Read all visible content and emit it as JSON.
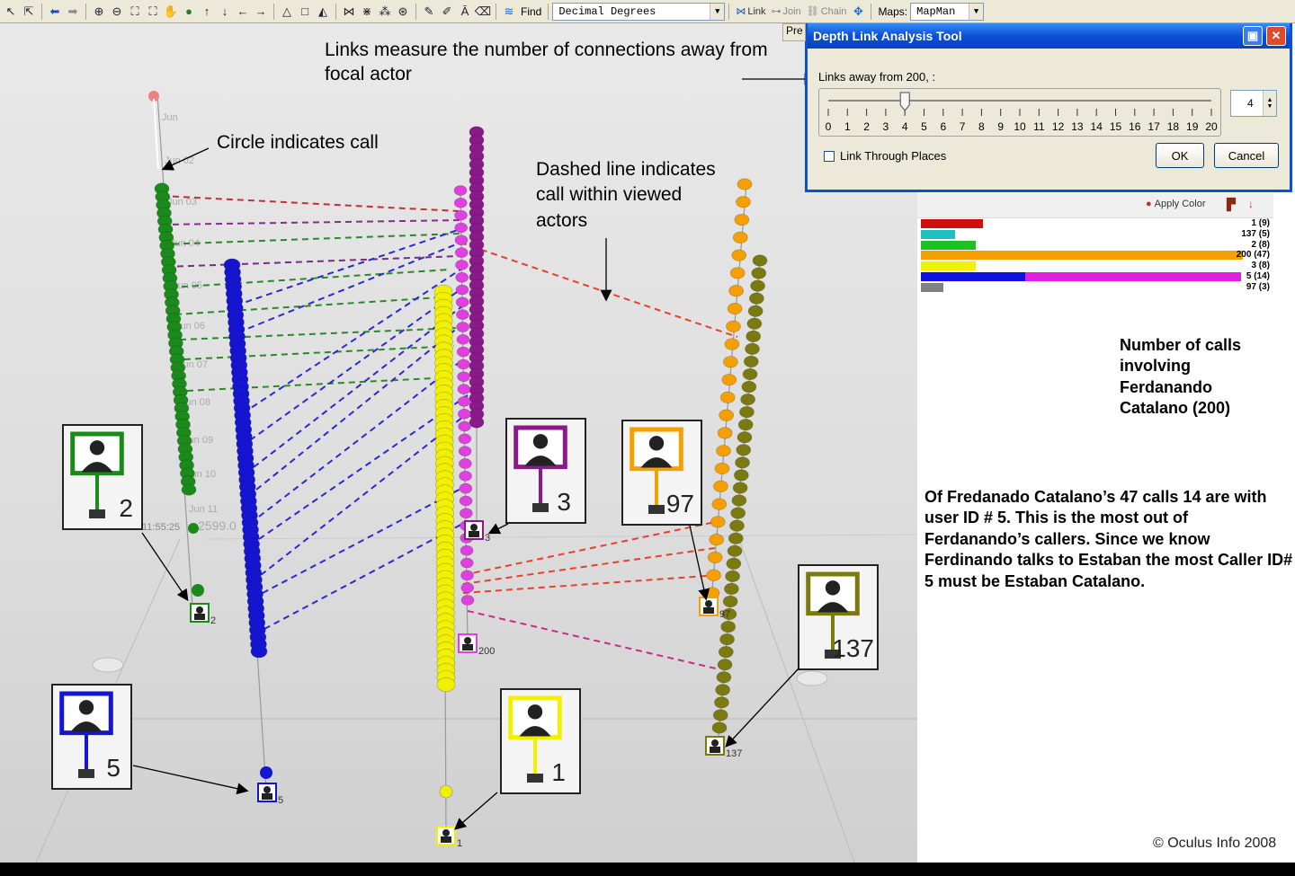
{
  "toolbar": {
    "find_label": "Find",
    "coord_format": "Decimal Degrees",
    "link_label": "Link",
    "join_label": "Join",
    "chain_label": "Chain",
    "maps_label": "Maps:",
    "map_value": "MapMan"
  },
  "dialog": {
    "title": "Depth Link Analysis Tool",
    "links_away_label": "Links away from 200, :",
    "slider_value": 4,
    "slider_max": 20,
    "tick_labels": [
      "0",
      "1",
      "2",
      "3",
      "4",
      "5",
      "6",
      "7",
      "8",
      "9",
      "10",
      "11",
      "12",
      "13",
      "14",
      "15",
      "16",
      "17",
      "18",
      "19",
      "20"
    ],
    "spin_value": "4",
    "checkbox_label": "Link Through Places",
    "ok_label": "OK",
    "cancel_label": "Cancel",
    "tab_fragment": "Pre"
  },
  "legend_panel": {
    "apply_color_label": "Apply Color",
    "rows": [
      {
        "label": "1 (9)",
        "color": "#cc1010",
        "count": 9
      },
      {
        "label": "137 (5)",
        "color": "#20c0c0",
        "count": 5
      },
      {
        "label": "2 (8)",
        "color": "#20c020",
        "count": 8
      },
      {
        "label": "200 (47)",
        "color": "#f5a000",
        "count": 47
      },
      {
        "label": "3 (8)",
        "color": "#f0f000",
        "count": 8
      },
      {
        "label": "5 (14)",
        "color": "#1010e0",
        "accent": "#e020e0",
        "count": 14
      },
      {
        "label": "97 (3)",
        "color": "#808080",
        "count": 3
      }
    ]
  },
  "annotations": {
    "links_measure": "Links measure the number of connections away from focal actor",
    "circle_call": "Circle indicates call",
    "dashed_line": "Dashed line indicates call within viewed actors",
    "number_calls": "Number of calls involving Ferdanando Catalano (200)",
    "summary": "Of Fredanado Catalano’s 47 calls 14 are with user ID # 5. This is the most out of Ferdanando’s callers. Since we know Ferdinando talks to Estaban the most Caller ID# 5 must be Estaban Catalano.",
    "copyright": "© Oculus Info 2008"
  },
  "scene": {
    "date_labels": [
      "Jun",
      "Jun 02",
      "Jun 03",
      "Jun 04",
      "Jun 05",
      "Jun 06",
      "Jun 07",
      "Jun 08",
      "Jun 09",
      "Jun 10",
      "Jun 11"
    ],
    "time_label": "11:55:25",
    "coord_label": "2599.0",
    "actors": [
      {
        "id": "2",
        "color": "#1a8a1a",
        "box_label": "2"
      },
      {
        "id": "5",
        "color": "#1414d2",
        "box_label": "5"
      },
      {
        "id": "3",
        "color": "#8a1a8a",
        "box_label": "3"
      },
      {
        "id": "97",
        "color": "#f5a000",
        "box_label": "97"
      },
      {
        "id": "137",
        "color": "#7a7a10",
        "box_label": "137"
      },
      {
        "id": "1",
        "color": "#f0f000",
        "box_label": "1"
      },
      {
        "id": "200",
        "color": "#e040e0",
        "box_label": "200"
      }
    ],
    "small_labels": {
      "a2": "2",
      "a5": "5",
      "a1": "1",
      "a200": "200",
      "a97": "97",
      "a137": "137",
      "a3": "3"
    }
  }
}
